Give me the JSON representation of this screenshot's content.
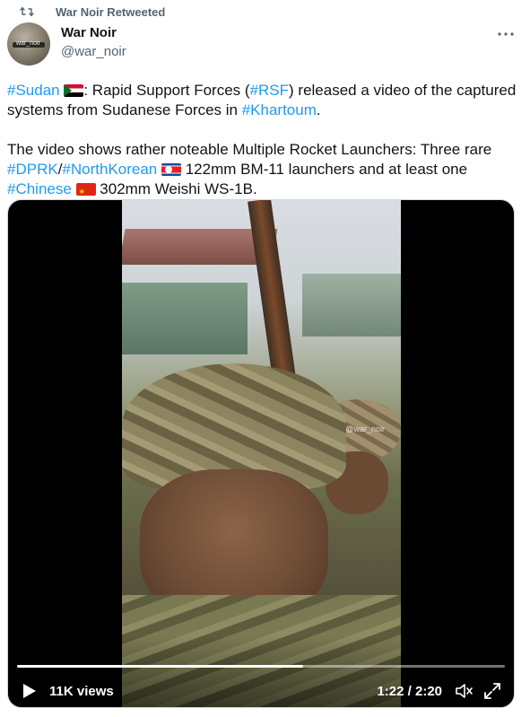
{
  "retweet": {
    "label": "War Noir Retweeted"
  },
  "author": {
    "name": "War Noir",
    "handle": "@war_noir",
    "avatar_text": "war_noir"
  },
  "tweet": {
    "p1": {
      "h_sudan": "#Sudan",
      "t1": ": Rapid Support Forces (",
      "h_rsf": "#RSF",
      "t2": ") released a video of the captured systems from Sudanese Forces in ",
      "h_khartoum": "#Khartoum",
      "t3": "."
    },
    "p2": {
      "t1": "The video shows rather noteable Multiple Rocket Launchers: Three rare ",
      "h_dprk": "#DPRK",
      "slash": "/",
      "h_nk": "#NorthKorean",
      "t2": " 122mm BM-11 launchers and at least one ",
      "h_chinese": "#Chinese",
      "t3": " 302mm Weishi WS-1B."
    }
  },
  "video": {
    "views": "11K views",
    "time": "1:22 / 2:20",
    "watermark": "@war_noir",
    "progress": 0.586
  },
  "colors": {
    "hashtag": "#1d9bf0",
    "secondary": "#536471"
  },
  "icons": [
    "retweet-icon",
    "more-icon",
    "play-icon",
    "volume-icon",
    "fullscreen-icon"
  ]
}
